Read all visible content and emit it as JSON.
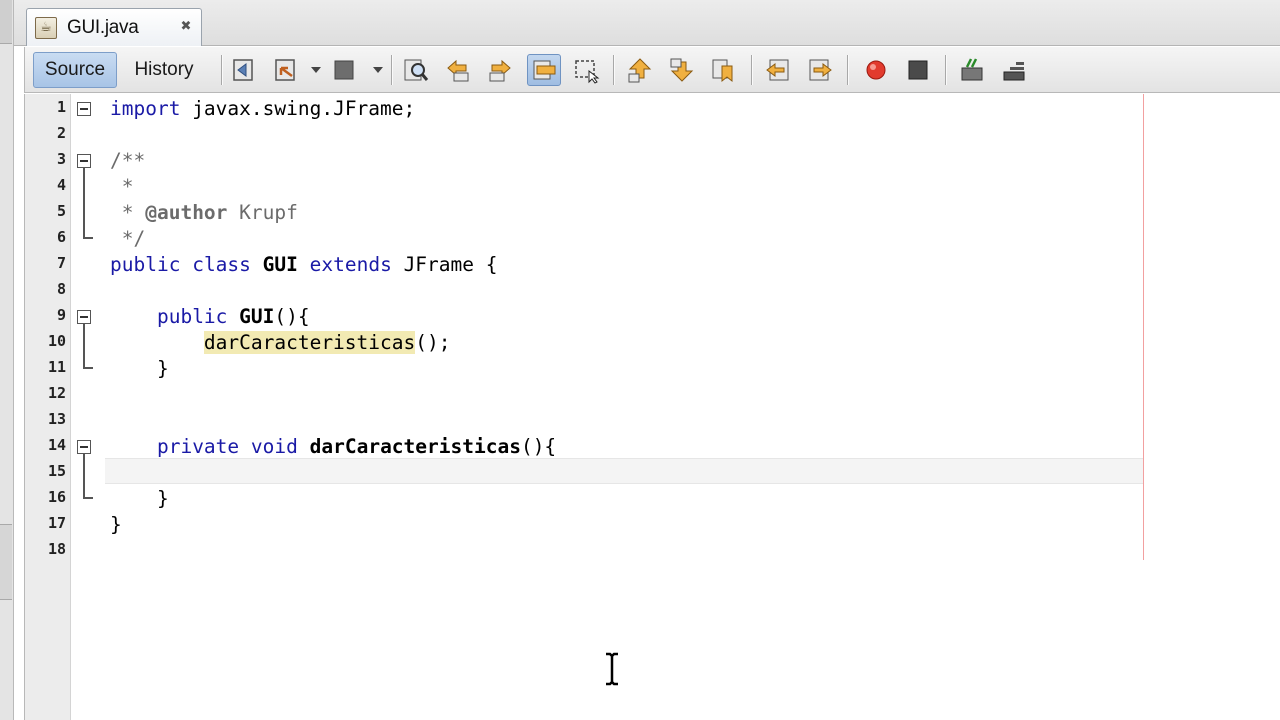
{
  "editor_tab": {
    "filename": "GUI.java",
    "close_glyph": "✖"
  },
  "toolbar": {
    "source_label": "Source",
    "history_label": "History",
    "icons": [
      "last-edit-icon",
      "back-icon",
      "forward-icon",
      "find-icon",
      "find-previous-icon",
      "find-next-icon",
      "toggle-highlight-icon",
      "toggle-rectangular-selection-icon",
      "previous-bookmark-icon",
      "next-bookmark-icon",
      "toggle-bookmark-icon",
      "shift-left-icon",
      "shift-right-icon",
      "start-macro-icon",
      "stop-macro-icon",
      "comment-icon",
      "uncomment-icon"
    ]
  },
  "code": {
    "line_numbers": [
      "1",
      "2",
      "3",
      "4",
      "5",
      "6",
      "7",
      "8",
      "9",
      "10",
      "11",
      "12",
      "13",
      "14",
      "15",
      "16",
      "17",
      "18"
    ],
    "l1": {
      "kw": "import",
      "rest": " javax.swing.JFrame;"
    },
    "l3": "/**",
    "l4": " *",
    "l5": {
      "pre": " * ",
      "tag": "@author",
      "rest": " Krupf"
    },
    "l6": " */",
    "l7": {
      "kw1": "public",
      "kw2": "class",
      "name": "GUI",
      "kw3": "extends",
      "rest": " JFrame {"
    },
    "l9": {
      "indent": "    ",
      "kw": "public",
      "name": "GUI",
      "rest": "(){"
    },
    "l10": {
      "indent": "        ",
      "call": "darCaracteristicas",
      "rest": "();"
    },
    "l11": "    }",
    "l14": {
      "indent": "    ",
      "kw1": "private",
      "kw2": "void",
      "name": "darCaracteristicas",
      "rest": "(){"
    },
    "l16": "    }",
    "l17": "}"
  },
  "colors": {
    "keyword": "#1a1aa6",
    "comment": "#6b6b6b",
    "highlight": "#f2eab3",
    "right_margin": "#f2a0a0",
    "active_view": "#a8c4e6"
  }
}
